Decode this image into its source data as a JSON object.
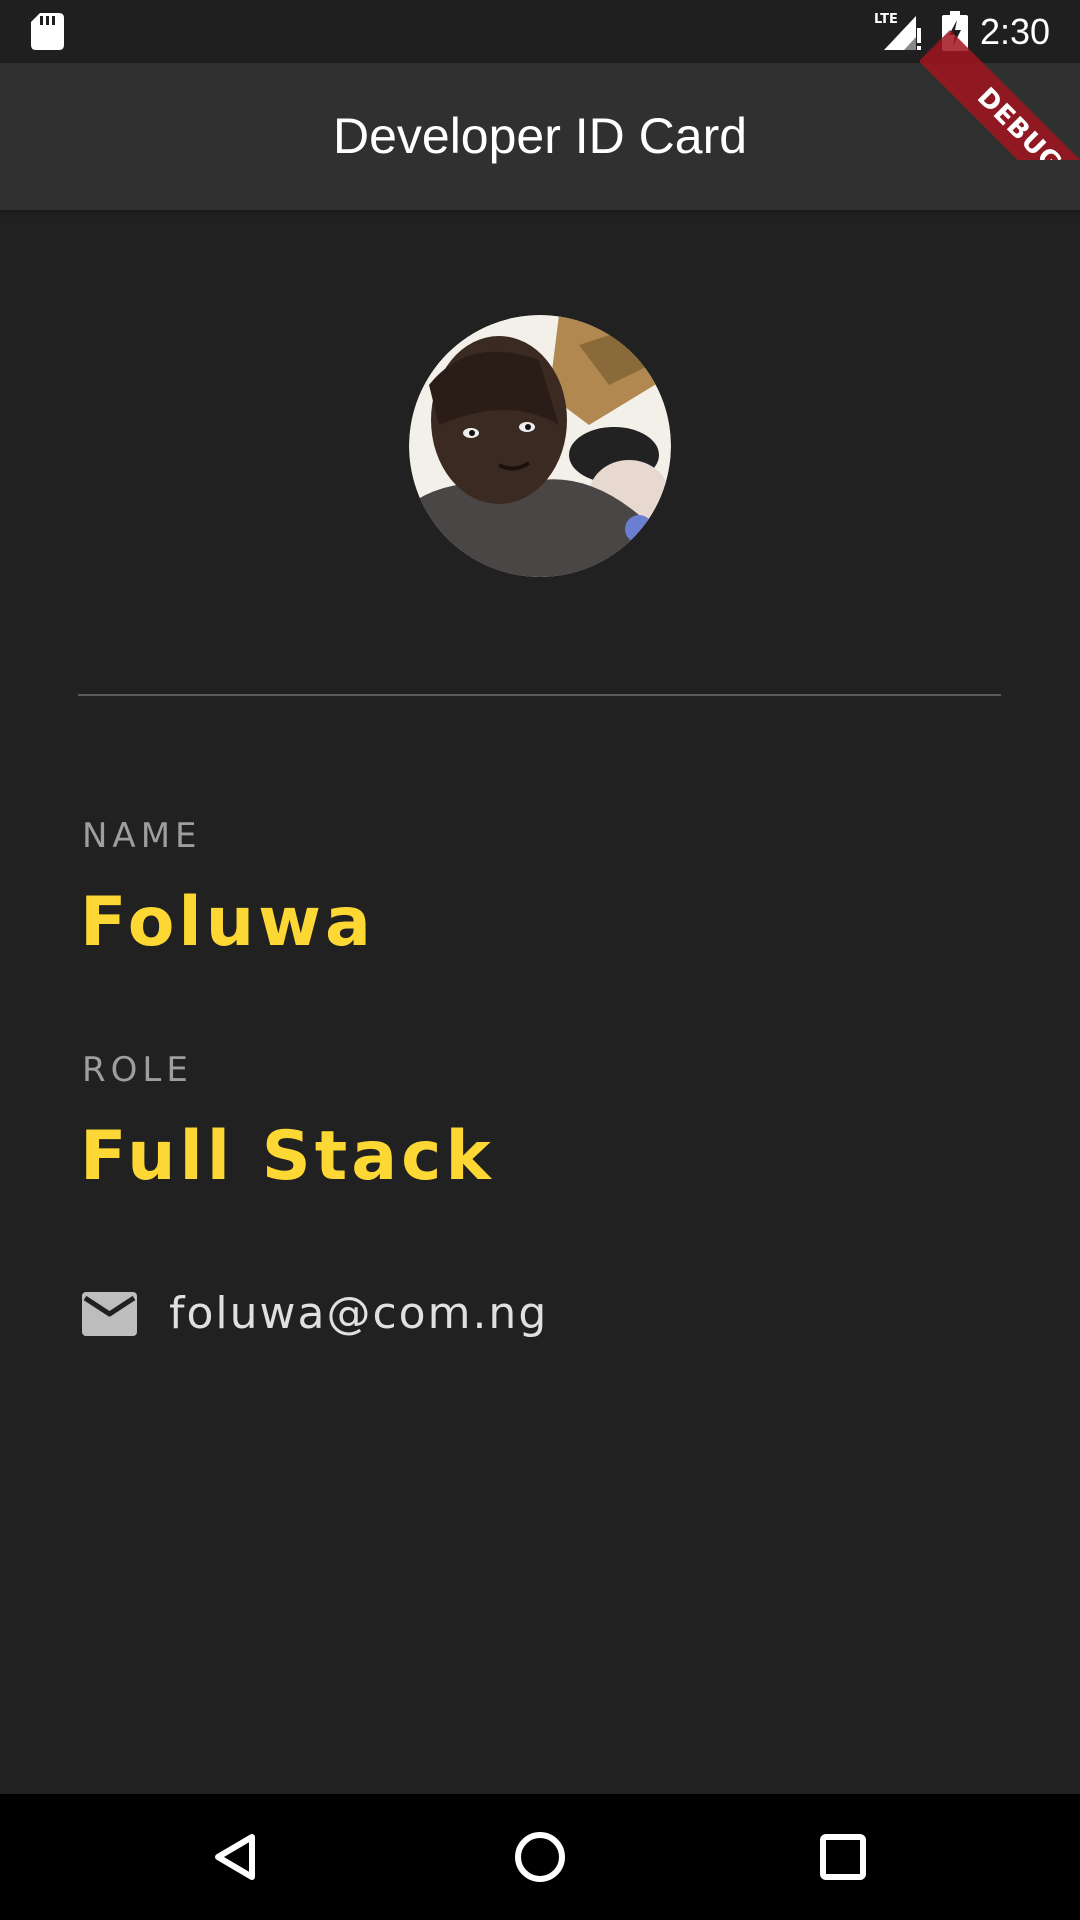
{
  "status_bar": {
    "time": "2:30",
    "network_label": "LTE",
    "icons": [
      "sd-card-icon",
      "lte-signal-icon",
      "battery-charging-icon"
    ]
  },
  "app_bar": {
    "title": "Developer ID Card"
  },
  "debug_banner": {
    "label": "DEBUG"
  },
  "profile": {
    "avatar_icon": "profile-photo",
    "name_label": "NAME",
    "name": "Foluwa",
    "role_label": "ROLE",
    "role": "Full Stack",
    "email_icon": "mail-icon",
    "email": "foluwa@com.ng"
  },
  "nav_bar": {
    "icons": [
      "back-icon",
      "home-icon",
      "recents-icon"
    ]
  },
  "colors": {
    "background": "#212121",
    "app_bar": "#303030",
    "accent": "#fdd835",
    "label": "#9e9e9e",
    "debug_ribbon": "#a0141e"
  }
}
